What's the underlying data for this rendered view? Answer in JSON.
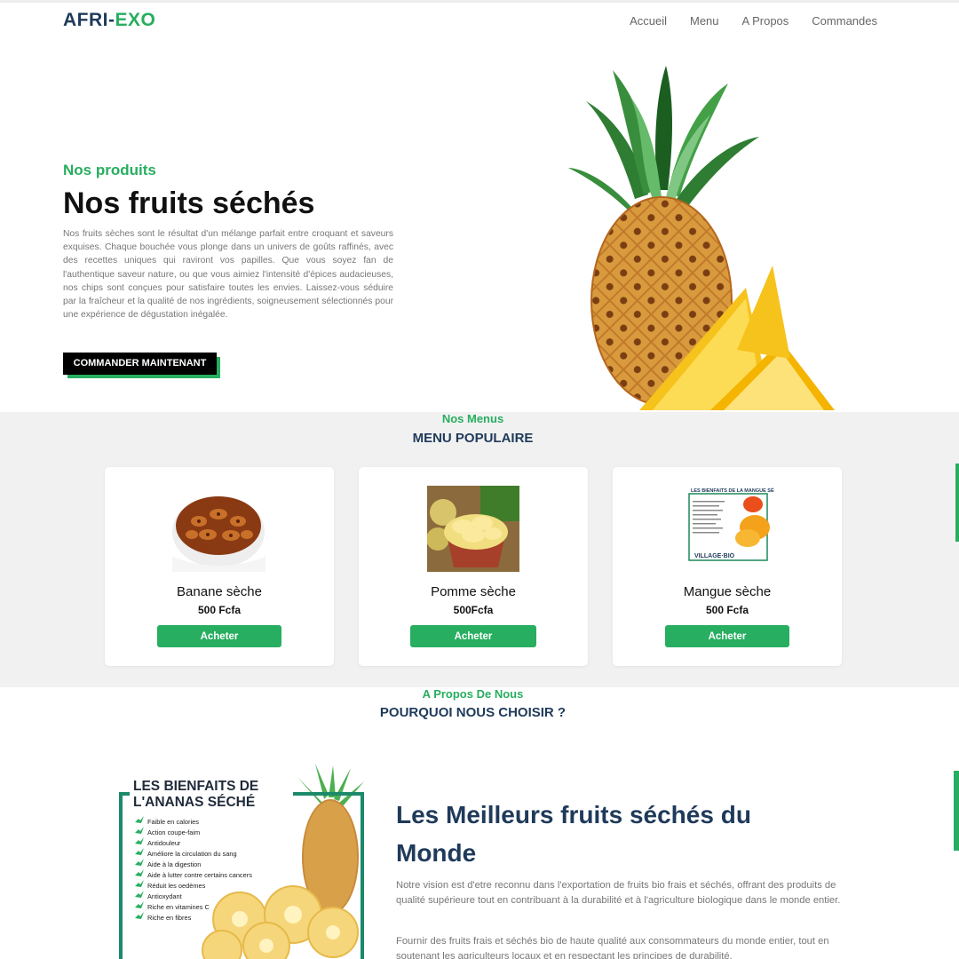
{
  "nav": {
    "logo_part1": "AFRI-",
    "logo_part2": "EXO",
    "links": [
      "Accueil",
      "Menu",
      "A Propos",
      "Commandes"
    ]
  },
  "hero": {
    "kicker": "Nos produits",
    "title": "Nos fruits séchés",
    "text": "Nos fruits sèches sont le résultat d'un mélange parfait entre croquant et saveurs exquises. Chaque bouchée vous plonge dans un univers de goûts raffinés, avec des recettes uniques qui raviront vos papilles. Que vous soyez fan de l'authentique saveur nature, ou que vous aimiez l'intensité d'épices audacieuses, nos chips sont conçues pour satisfaire toutes les envies. Laissez-vous séduire par la fraîcheur et la qualité de nos ingrédients, soigneusement sélectionnés pour une expérience de dégustation inégalée.",
    "button_label": "COMMANDER MAINTENANT",
    "image_icon": "pineapple-image"
  },
  "menu": {
    "kicker": "Nos Menus",
    "title": "MENU POPULAIRE",
    "items": [
      {
        "name": "Banane sèche",
        "price": "500 Fcfa",
        "button": "Acheter"
      },
      {
        "name": "Pomme sèche",
        "price": "500Fcfa",
        "button": "Acheter"
      },
      {
        "name": "Mangue sèche",
        "price": "500 Fcfa",
        "button": "Acheter"
      }
    ],
    "mango_poster_title": "LES BIENFAITS DE LA MANGUE SÉCHÉE",
    "mango_poster_brand": "VILLAGE·BIO"
  },
  "about": {
    "kicker": "A Propos De Nous",
    "title_small": "POURQUOI NOUS CHOISIR ?",
    "headline": "Les Meilleurs fruits séchés du Monde",
    "p1": "Notre vision est d'etre reconnu dans l'exportation de fruits bio frais et séchés, offrant des produits de qualité supérieure tout en contribuant à la durabilité et à l'agriculture biologique dans le monde entier.",
    "p2": "Fournir des fruits frais et séchés bio de haute qualité aux consommateurs du monde entier, tout en soutenant les agriculteurs locaux et en respectant les principes de durabilité.",
    "poster": {
      "title_line1": "LES BIENFAITS DE",
      "title_line2": "L'ANANAS SÉCHÉ",
      "benefits": [
        "Faible en calories",
        "Action coupe-faim",
        "Antidouleur",
        "Améliore la circulation du sang",
        "Aide à la digestion",
        "Aide à lutter contre certains cancers",
        "Réduit les oedèmes",
        "Antioxydant",
        "Riche en vitamines C",
        "Riche en fibres"
      ]
    }
  },
  "colors": {
    "accent_green": "#27ae60",
    "navy": "#1f3a5a",
    "section_gray": "#f1f1f1"
  }
}
